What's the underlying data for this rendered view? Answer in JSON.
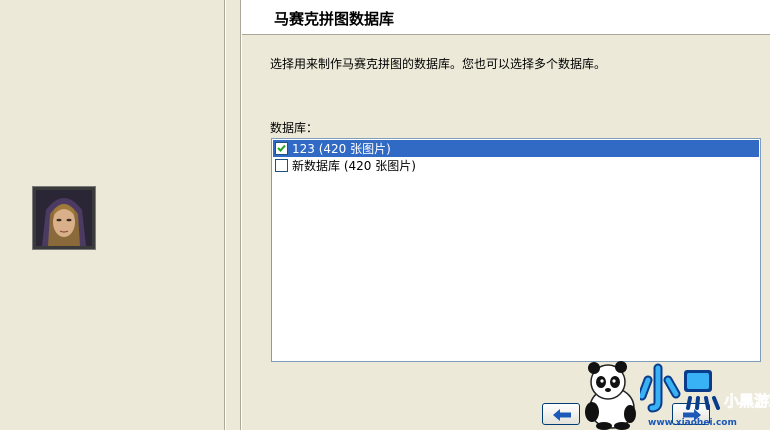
{
  "page": {
    "title": "马赛克拼图数据库",
    "description": "选择用来制作马赛克拼图的数据库。您也可以选择多个数据库。",
    "database_label": "数据库："
  },
  "databases": [
    {
      "label": "123 (420 张图片)",
      "checked": true,
      "selected": true
    },
    {
      "label": "新数据库 (420 张图片)",
      "checked": false,
      "selected": false
    }
  ],
  "colors": {
    "window_bg": "#ECE9D8",
    "selection": "#316AC5",
    "list_border": "#7F9DB9",
    "checkbox_border": "#1C5180",
    "check_mark": "#21A121"
  },
  "icons": {
    "avatar": "hooded-hero-portrait",
    "back": "left-arrow-icon",
    "next": "right-arrow-icon"
  },
  "watermark": {
    "brand": "小黑游戏",
    "url": "www.xiaohei.com"
  }
}
